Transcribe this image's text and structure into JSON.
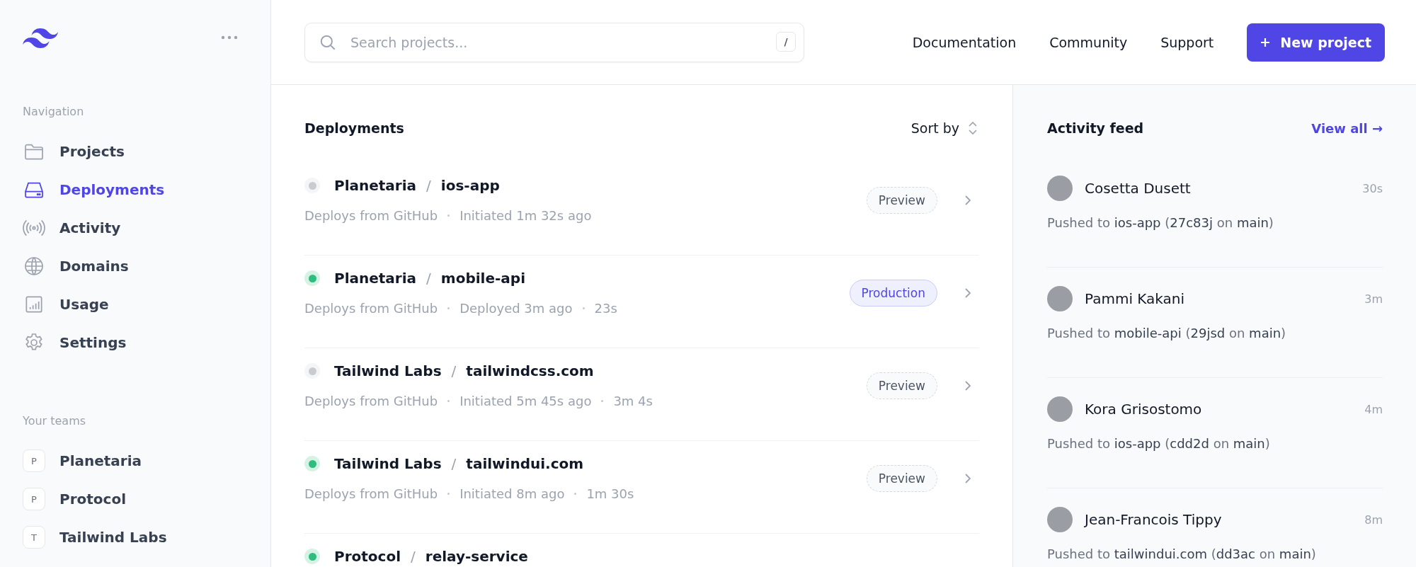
{
  "sidebar": {
    "section_title": "Navigation",
    "items": [
      {
        "label": "Projects",
        "selected": false
      },
      {
        "label": "Deployments",
        "selected": true
      },
      {
        "label": "Activity",
        "selected": false
      },
      {
        "label": "Domains",
        "selected": false
      },
      {
        "label": "Usage",
        "selected": false
      },
      {
        "label": "Settings",
        "selected": false
      }
    ],
    "teams_title": "Your teams",
    "teams": [
      {
        "initial": "P",
        "name": "Planetaria"
      },
      {
        "initial": "P",
        "name": "Protocol"
      },
      {
        "initial": "T",
        "name": "Tailwind Labs"
      }
    ]
  },
  "topbar": {
    "search": {
      "placeholder": "Search projects...",
      "shortcut": "/"
    },
    "links": [
      "Documentation",
      "Community",
      "Support"
    ],
    "button": "New project"
  },
  "deployments": {
    "title": "Deployments",
    "sort": "Sort by",
    "rows": [
      {
        "team": "Planetaria",
        "separator": "/",
        "project": "ios-app",
        "color": "#c9cbd1",
        "meta": [
          "Deploys from GitHub",
          "Initiated 1m 32s ago"
        ],
        "badge": {
          "kind": "preview",
          "label": "Preview"
        }
      },
      {
        "team": "Planetaria",
        "separator": "/",
        "project": "mobile-api",
        "color": "#2ebd7f",
        "meta": [
          "Deploys from GitHub",
          "Deployed 3m ago",
          "23s"
        ],
        "badge": {
          "kind": "production",
          "label": "Production"
        }
      },
      {
        "team": "Tailwind Labs",
        "separator": "/",
        "project": "tailwindcss.com",
        "color": "#c9cbd1",
        "meta": [
          "Deploys from GitHub",
          "Initiated 5m 45s ago",
          "3m 4s"
        ],
        "badge": {
          "kind": "preview",
          "label": "Preview"
        }
      },
      {
        "team": "Tailwind Labs",
        "separator": "/",
        "project": "tailwindui.com",
        "color": "#2ebd7f",
        "meta": [
          "Deploys from GitHub",
          "Initiated 8m ago",
          "1m 30s"
        ],
        "badge": {
          "kind": "preview",
          "label": "Preview"
        }
      },
      {
        "team": "Protocol",
        "separator": "/",
        "project": "relay-service",
        "color": "#2ebd7f"
      }
    ]
  },
  "activity": {
    "title": "Activity feed",
    "link": "View all →",
    "items": [
      {
        "name": "Cosetta Dusett",
        "time": "30s",
        "text": "Pushed to **ios-app** (**27c83j** on **main**)"
      },
      {
        "name": "Pammi Kakani",
        "time": "3m",
        "text": "Pushed to **mobile-api** (**29jsd** on **main**)"
      },
      {
        "name": "Kora Grisostomo",
        "time": "4m",
        "text": "Pushed to **ios-app** (**cdd2d** on **main**)"
      },
      {
        "name": "Jean-Francois Tippy",
        "time": "8m",
        "text": "Pushed to **tailwindui.com** (**dd3ac** on **main**)"
      }
    ]
  }
}
